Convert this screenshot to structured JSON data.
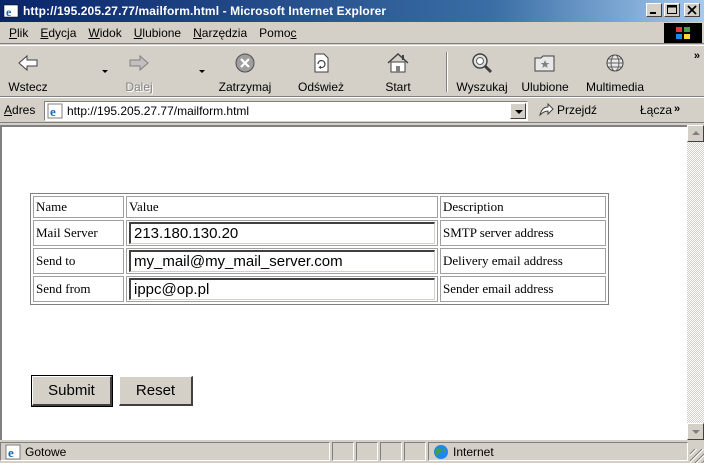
{
  "window": {
    "title": "http://195.205.27.77/mailform.html - Microsoft Internet Explorer"
  },
  "menu": {
    "items": [
      {
        "label": "Plik",
        "accel": "P",
        "rest": "lik"
      },
      {
        "label": "Edycja",
        "accel": "E",
        "rest": "dycja"
      },
      {
        "label": "Widok",
        "accel": "W",
        "rest": "idok"
      },
      {
        "label": "Ulubione",
        "accel": "U",
        "rest": "lubione"
      },
      {
        "label": "Narzędzia",
        "accel": "N",
        "rest": "arzędzia"
      },
      {
        "label": "Pomoc",
        "pre": "Pomo",
        "accel": "c"
      }
    ]
  },
  "toolbar": {
    "back": "Wstecz",
    "forward": "Dalej",
    "stop": "Zatrzymaj",
    "refresh": "Odśwież",
    "home": "Start",
    "search": "Wyszukaj",
    "favorites": "Ulubione",
    "media": "Multimedia",
    "more": "»"
  },
  "address": {
    "label_accel": "A",
    "label_rest": "dres",
    "url": "http://195.205.27.77/mailform.html",
    "go": "Przejdź",
    "links": "Łącza",
    "links_more": "»"
  },
  "form": {
    "headers": {
      "name": "Name",
      "value": "Value",
      "description": "Description"
    },
    "rows": [
      {
        "name": "Mail Server",
        "value": "213.180.130.20",
        "description": "SMTP server address"
      },
      {
        "name": "Send to",
        "value": "my_mail@my_mail_server.com",
        "description": "Delivery email address"
      },
      {
        "name": "Send from",
        "value": "ippc@op.pl",
        "description": "Sender email address"
      }
    ],
    "submit": "Submit",
    "reset": "Reset"
  },
  "status": {
    "text": "Gotowe",
    "zone": "Internet"
  },
  "colors": {
    "titlebar_start": "#0a246a",
    "titlebar_end": "#a6caf0",
    "chrome": "#d4d0c8"
  }
}
